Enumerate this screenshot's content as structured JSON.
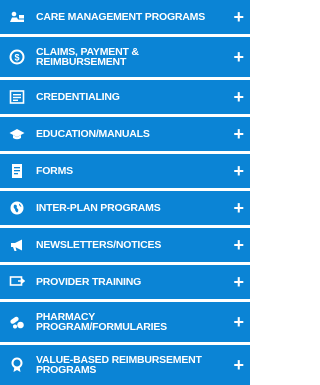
{
  "accent_color": "#0b84d5",
  "menu": {
    "items": [
      {
        "label": "CARE MANAGEMENT PROGRAMS",
        "icon": "nurse-icon",
        "expand": "+"
      },
      {
        "label": "CLAIMS, PAYMENT &\nREIMBURSEMENT",
        "icon": "dollar-coin-icon",
        "expand": "+"
      },
      {
        "label": "CREDENTIALING",
        "icon": "document-list-icon",
        "expand": "+"
      },
      {
        "label": "EDUCATION/MANUALS",
        "icon": "graduation-cap-icon",
        "expand": "+"
      },
      {
        "label": "FORMS",
        "icon": "form-icon",
        "expand": "+"
      },
      {
        "label": "INTER-PLAN PROGRAMS",
        "icon": "globe-icon",
        "expand": "+"
      },
      {
        "label": "NEWSLETTERS/NOTICES",
        "icon": "megaphone-icon",
        "expand": "+"
      },
      {
        "label": "PROVIDER TRAINING",
        "icon": "presentation-icon",
        "expand": "+"
      },
      {
        "label": "PHARMACY\nPROGRAM/FORMULARIES",
        "icon": "pills-icon",
        "expand": "+"
      },
      {
        "label": "VALUE-BASED REIMBURSEMENT\nPROGRAMS",
        "icon": "award-ribbon-icon",
        "expand": "+"
      }
    ]
  }
}
